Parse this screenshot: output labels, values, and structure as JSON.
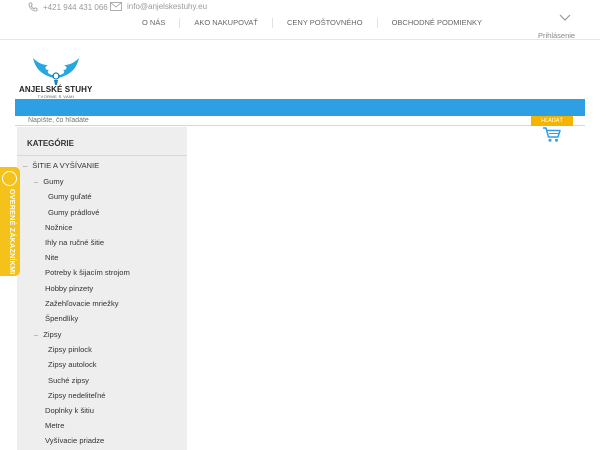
{
  "header": {
    "phone": "+421 944 431 066",
    "email": "info@anjelskestuhy.eu",
    "nav": [
      "O NÁS",
      "AKO NAKUPOVAŤ",
      "CENY POŠTOVNÉHO",
      "OBCHODNÉ PODMIENKY"
    ],
    "login": "Prihlásenie"
  },
  "logo": {
    "title": "ANJELSKÉ STUHY",
    "subtitle": "TVORME S VAMI"
  },
  "search": {
    "placeholder": "Napíšte, čo hľadáte",
    "button": "HĽADAŤ"
  },
  "sidebar": {
    "title": "KATEGÓRIE",
    "items": [
      {
        "label": "ŠITIE A VYŠÍVANIE",
        "level": 0,
        "expanded": true
      },
      {
        "label": "Gumy",
        "level": 1,
        "expanded": true
      },
      {
        "label": "Gumy guľaté",
        "level": 2
      },
      {
        "label": "Gumy prádlové",
        "level": 2
      },
      {
        "label": "Nožnice",
        "level": 1
      },
      {
        "label": "Ihly na ručné šitie",
        "level": 1
      },
      {
        "label": "Nite",
        "level": 1
      },
      {
        "label": "Potreby k šijacím strojom",
        "level": 1
      },
      {
        "label": "Hobby pinzety",
        "level": 1
      },
      {
        "label": "Zažehľovacie mriežky",
        "level": 1
      },
      {
        "label": "Špendlíky",
        "level": 1
      },
      {
        "label": "Zipsy",
        "level": 1,
        "expanded": true
      },
      {
        "label": "Zipsy pinlock",
        "level": 2
      },
      {
        "label": "Zipsy autolock",
        "level": 2
      },
      {
        "label": "Suché zipsy",
        "level": 2
      },
      {
        "label": "Zipsy nedeliteľné",
        "level": 2
      },
      {
        "label": "Doplnky k šitiu",
        "level": 1
      },
      {
        "label": "Metre",
        "level": 1
      },
      {
        "label": "Vyšívacie priadze",
        "level": 1
      }
    ]
  },
  "badge": {
    "label": "OVERENÉ ZÁKAZNÍKMI"
  },
  "colors": {
    "accent_blue": "#2f9fe3",
    "badge_yellow": "#f4c21a",
    "search_button": "#f4b400",
    "sidebar_bg": "#eeeeee"
  }
}
